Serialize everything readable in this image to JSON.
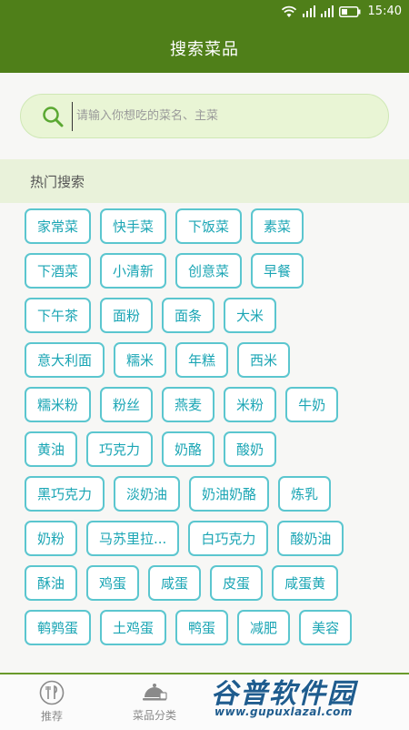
{
  "status_bar": {
    "time": "15:40",
    "icons": [
      "wifi-icon",
      "signal-icon",
      "signal-icon",
      "battery-icon"
    ]
  },
  "app_bar": {
    "title": "搜索菜品"
  },
  "search": {
    "placeholder": "请输入你想吃的菜名、主菜",
    "value": ""
  },
  "hot_search": {
    "title": "热门搜索",
    "rows": [
      [
        "家常菜",
        "快手菜",
        "下饭菜",
        "素菜"
      ],
      [
        "下酒菜",
        "小清新",
        "创意菜",
        "早餐"
      ],
      [
        "下午茶",
        "面粉",
        "面条",
        "大米"
      ],
      [
        "意大利面",
        "糯米",
        "年糕",
        "西米"
      ],
      [
        "糯米粉",
        "粉丝",
        "燕麦",
        "米粉",
        "牛奶"
      ],
      [
        "黄油",
        "巧克力",
        "奶酪",
        "酸奶"
      ],
      [
        "黑巧克力",
        "淡奶油",
        "奶油奶酪",
        "炼乳"
      ],
      [
        "奶粉",
        "马苏里拉...",
        "白巧克力",
        "酸奶油"
      ],
      [
        "酥油",
        "鸡蛋",
        "咸蛋",
        "皮蛋",
        "咸蛋黄"
      ],
      [
        "鹌鹑蛋",
        "土鸡蛋",
        "鸭蛋",
        "减肥",
        "美容"
      ]
    ]
  },
  "bottom_nav": {
    "items": [
      {
        "label": "推荐",
        "icon": "fork-knife-icon"
      },
      {
        "label": "菜品分类",
        "icon": "cloche-icon"
      }
    ]
  },
  "watermark": {
    "title": "谷普软件园",
    "url": "www.gupuxlazal.com"
  },
  "colors": {
    "primary_green": "#4f7f19",
    "tag_border": "#5bc6cf",
    "tag_text": "#1aa5b4",
    "search_bg": "#e9f5d5",
    "header_bg": "#e9f2da"
  }
}
